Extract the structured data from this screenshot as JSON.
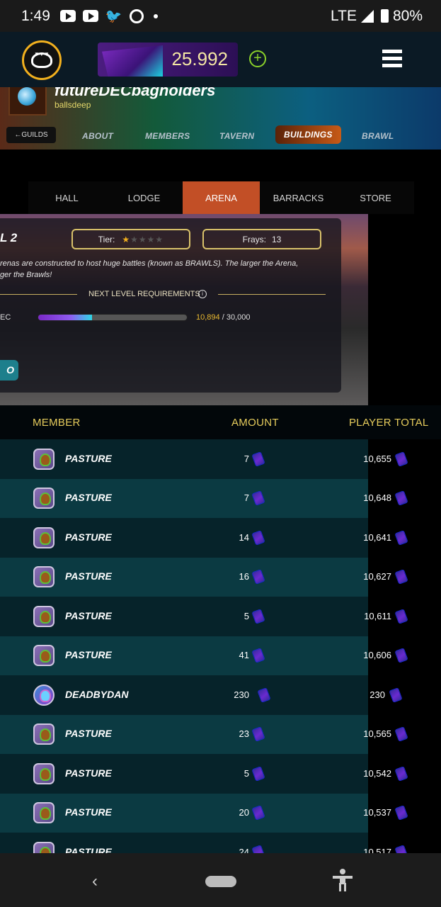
{
  "status_bar": {
    "time": "1:49",
    "network": "LTE",
    "battery": "80%"
  },
  "header": {
    "dec_balance": "25.992",
    "plus_label": "+"
  },
  "guild": {
    "name": "futureDECbagholders",
    "subtitle": "ballsdeep",
    "back_label": "GUILDS",
    "nav": [
      {
        "label": "ABOUT"
      },
      {
        "label": "MEMBERS"
      },
      {
        "label": "TAVERN"
      },
      {
        "label": "BUILDINGS"
      },
      {
        "label": "BRAWL"
      }
    ]
  },
  "tabs": [
    {
      "label": "HALL"
    },
    {
      "label": "LODGE"
    },
    {
      "label": "ARENA"
    },
    {
      "label": "BARRACKS"
    },
    {
      "label": "STORE"
    }
  ],
  "arena": {
    "level_title": "L 2",
    "tier_label": "Tier:",
    "tier_stars_filled": 1,
    "tier_stars_total": 5,
    "frays_label": "Frays:",
    "frays_value": "13",
    "desc_line1": "renas are constructed to host huge battles (known as BRAWLS). The larger the Arena,",
    "desc_line2": "ger the Brawls!",
    "requirements_label": "NEXT LEVEL REQUIREMENTS",
    "resource_label": "EC",
    "progress_current": "10,894",
    "progress_sep": " / ",
    "progress_target": "30,000",
    "progress_fraction": 0.363,
    "go_label": "O"
  },
  "table": {
    "headers": {
      "member": "MEMBER",
      "amount": "AMOUNT",
      "player_total": "PLAYER TOTAL"
    },
    "rows": [
      {
        "member": "PASTURE",
        "amount": "7",
        "total": "10,655"
      },
      {
        "member": "PASTURE",
        "amount": "7",
        "total": "10,648"
      },
      {
        "member": "PASTURE",
        "amount": "14",
        "total": "10,641"
      },
      {
        "member": "PASTURE",
        "amount": "16",
        "total": "10,627"
      },
      {
        "member": "PASTURE",
        "amount": "5",
        "total": "10,611"
      },
      {
        "member": "PASTURE",
        "amount": "41",
        "total": "10,606"
      },
      {
        "member": "DEADBYDAN",
        "amount": "230",
        "total": "230"
      },
      {
        "member": "PASTURE",
        "amount": "23",
        "total": "10,565"
      },
      {
        "member": "PASTURE",
        "amount": "5",
        "total": "10,542"
      },
      {
        "member": "PASTURE",
        "amount": "20",
        "total": "10,537"
      },
      {
        "member": "PASTURE",
        "amount": "24",
        "total": "10,517"
      }
    ]
  },
  "icons": {
    "back": "‹",
    "arrow_left": "←",
    "info": "i",
    "star": "★"
  },
  "colors": {
    "accent_gold": "#e6cc5c",
    "active_tab": "#c24f26",
    "progress_purple": "#7a28c8"
  }
}
